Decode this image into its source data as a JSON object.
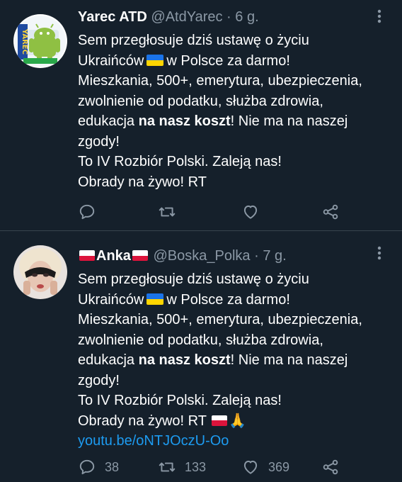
{
  "tweets": [
    {
      "name": "Yarec ATD",
      "handle": "@AtdYarec",
      "separator": "·",
      "time": "6 g.",
      "avatar_text": "YAREC",
      "body": {
        "l1": "Sem przegłosuje dziś ustawę o życiu",
        "l2a": "Ukraińców",
        "l2b": "w Polsce za darmo!",
        "l3": "Mieszkania, 500+, emerytura, ubezpieczenia,",
        "l4": "zwolnienie od podatku, służba zdrowia,",
        "l5a": "edukacja",
        "l5b": "na nasz koszt",
        "l5c": "! Nie ma na naszej",
        "l6": "zgody!",
        "l7": "To IV Rozbiór Polski. Zaleją nas!",
        "l8": "Obrady na żywo! RT"
      },
      "actions": {
        "replies": "",
        "retweets": "",
        "likes": ""
      }
    },
    {
      "name": "Anka",
      "handle": "@Boska_Polka",
      "separator": "·",
      "time": "7 g.",
      "body": {
        "l1": "Sem przegłosuje dziś ustawę o życiu",
        "l2a": "Ukraińców",
        "l2b": "w Polsce za darmo!",
        "l3": "Mieszkania, 500+, emerytura, ubezpieczenia,",
        "l4": "zwolnienie od podatku, służba zdrowia,",
        "l5a": "edukacja",
        "l5b": "na nasz koszt",
        "l5c": "! Nie ma na naszej",
        "l6": "zgody!",
        "l7": "To IV Rozbiór Polski. Zaleją nas!",
        "l8": "Obrady na żywo! RT",
        "l8_emoji": "🙏",
        "link": "youtu.be/oNTJOczU-Oo"
      },
      "actions": {
        "replies": "38",
        "retweets": "133",
        "likes": "369"
      }
    }
  ],
  "colors": {
    "background": "#15202b",
    "secondary_text": "#8b98a5",
    "link": "#1d9bf0",
    "divider": "#38444d"
  },
  "icons": [
    "more-icon",
    "reply-icon",
    "retweet-icon",
    "like-icon",
    "share-icon",
    "flag-pl-icon",
    "flag-ua-icon",
    "pray-icon"
  ]
}
